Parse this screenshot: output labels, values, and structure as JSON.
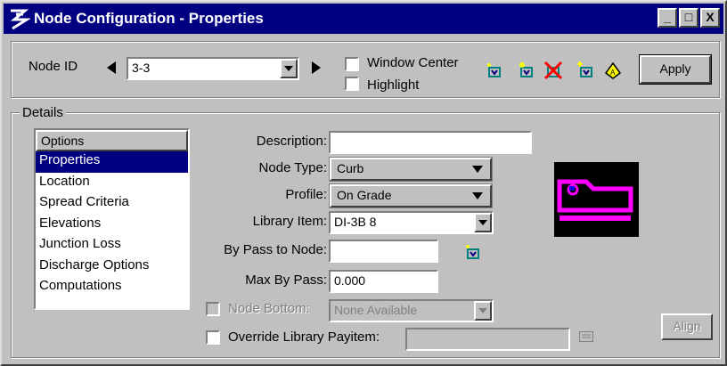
{
  "window": {
    "title": "Node Configuration - Properties",
    "buttons": {
      "minimize": "_",
      "maximize": "□",
      "close": "X"
    }
  },
  "toolbar": {
    "node_id_label": "Node ID",
    "node_id_value": "3-3",
    "window_center_label": "Window Center",
    "window_center_checked": false,
    "highlight_label": "Highlight",
    "highlight_checked": false,
    "apply_label": "Apply",
    "tool_icons": [
      "select-node-icon",
      "add-node-icon",
      "delete-node-icon",
      "new-node-icon",
      "text-node-icon"
    ]
  },
  "details": {
    "group_label": "Details",
    "options_header": "Options",
    "options": [
      "Properties",
      "Location",
      "Spread Criteria",
      "Elevations",
      "Junction Loss",
      "Discharge Options",
      "Computations"
    ],
    "selected_option": "Properties"
  },
  "form": {
    "description_label": "Description:",
    "description_value": "",
    "node_type_label": "Node Type:",
    "node_type_value": "Curb",
    "profile_label": "Profile:",
    "profile_value": "On Grade",
    "library_item_label": "Library Item:",
    "library_item_value": "DI-3B 8",
    "bypass_label": "By Pass to Node:",
    "bypass_value": "",
    "max_bypass_label": "Max By Pass:",
    "max_bypass_value": "0.000",
    "node_bottom_label": "Node Bottom:",
    "node_bottom_value": "None Available",
    "override_label": "Override Library Payitem:",
    "override_value": "",
    "align_label": "Align"
  },
  "colors": {
    "title_bar": "#000080",
    "face": "#c0c0c0",
    "selection": "#000080",
    "preview_bg": "#000000",
    "preview_shape": "#ff00ff",
    "tool_yellow": "#ffff00",
    "tool_red": "#ff0000"
  }
}
